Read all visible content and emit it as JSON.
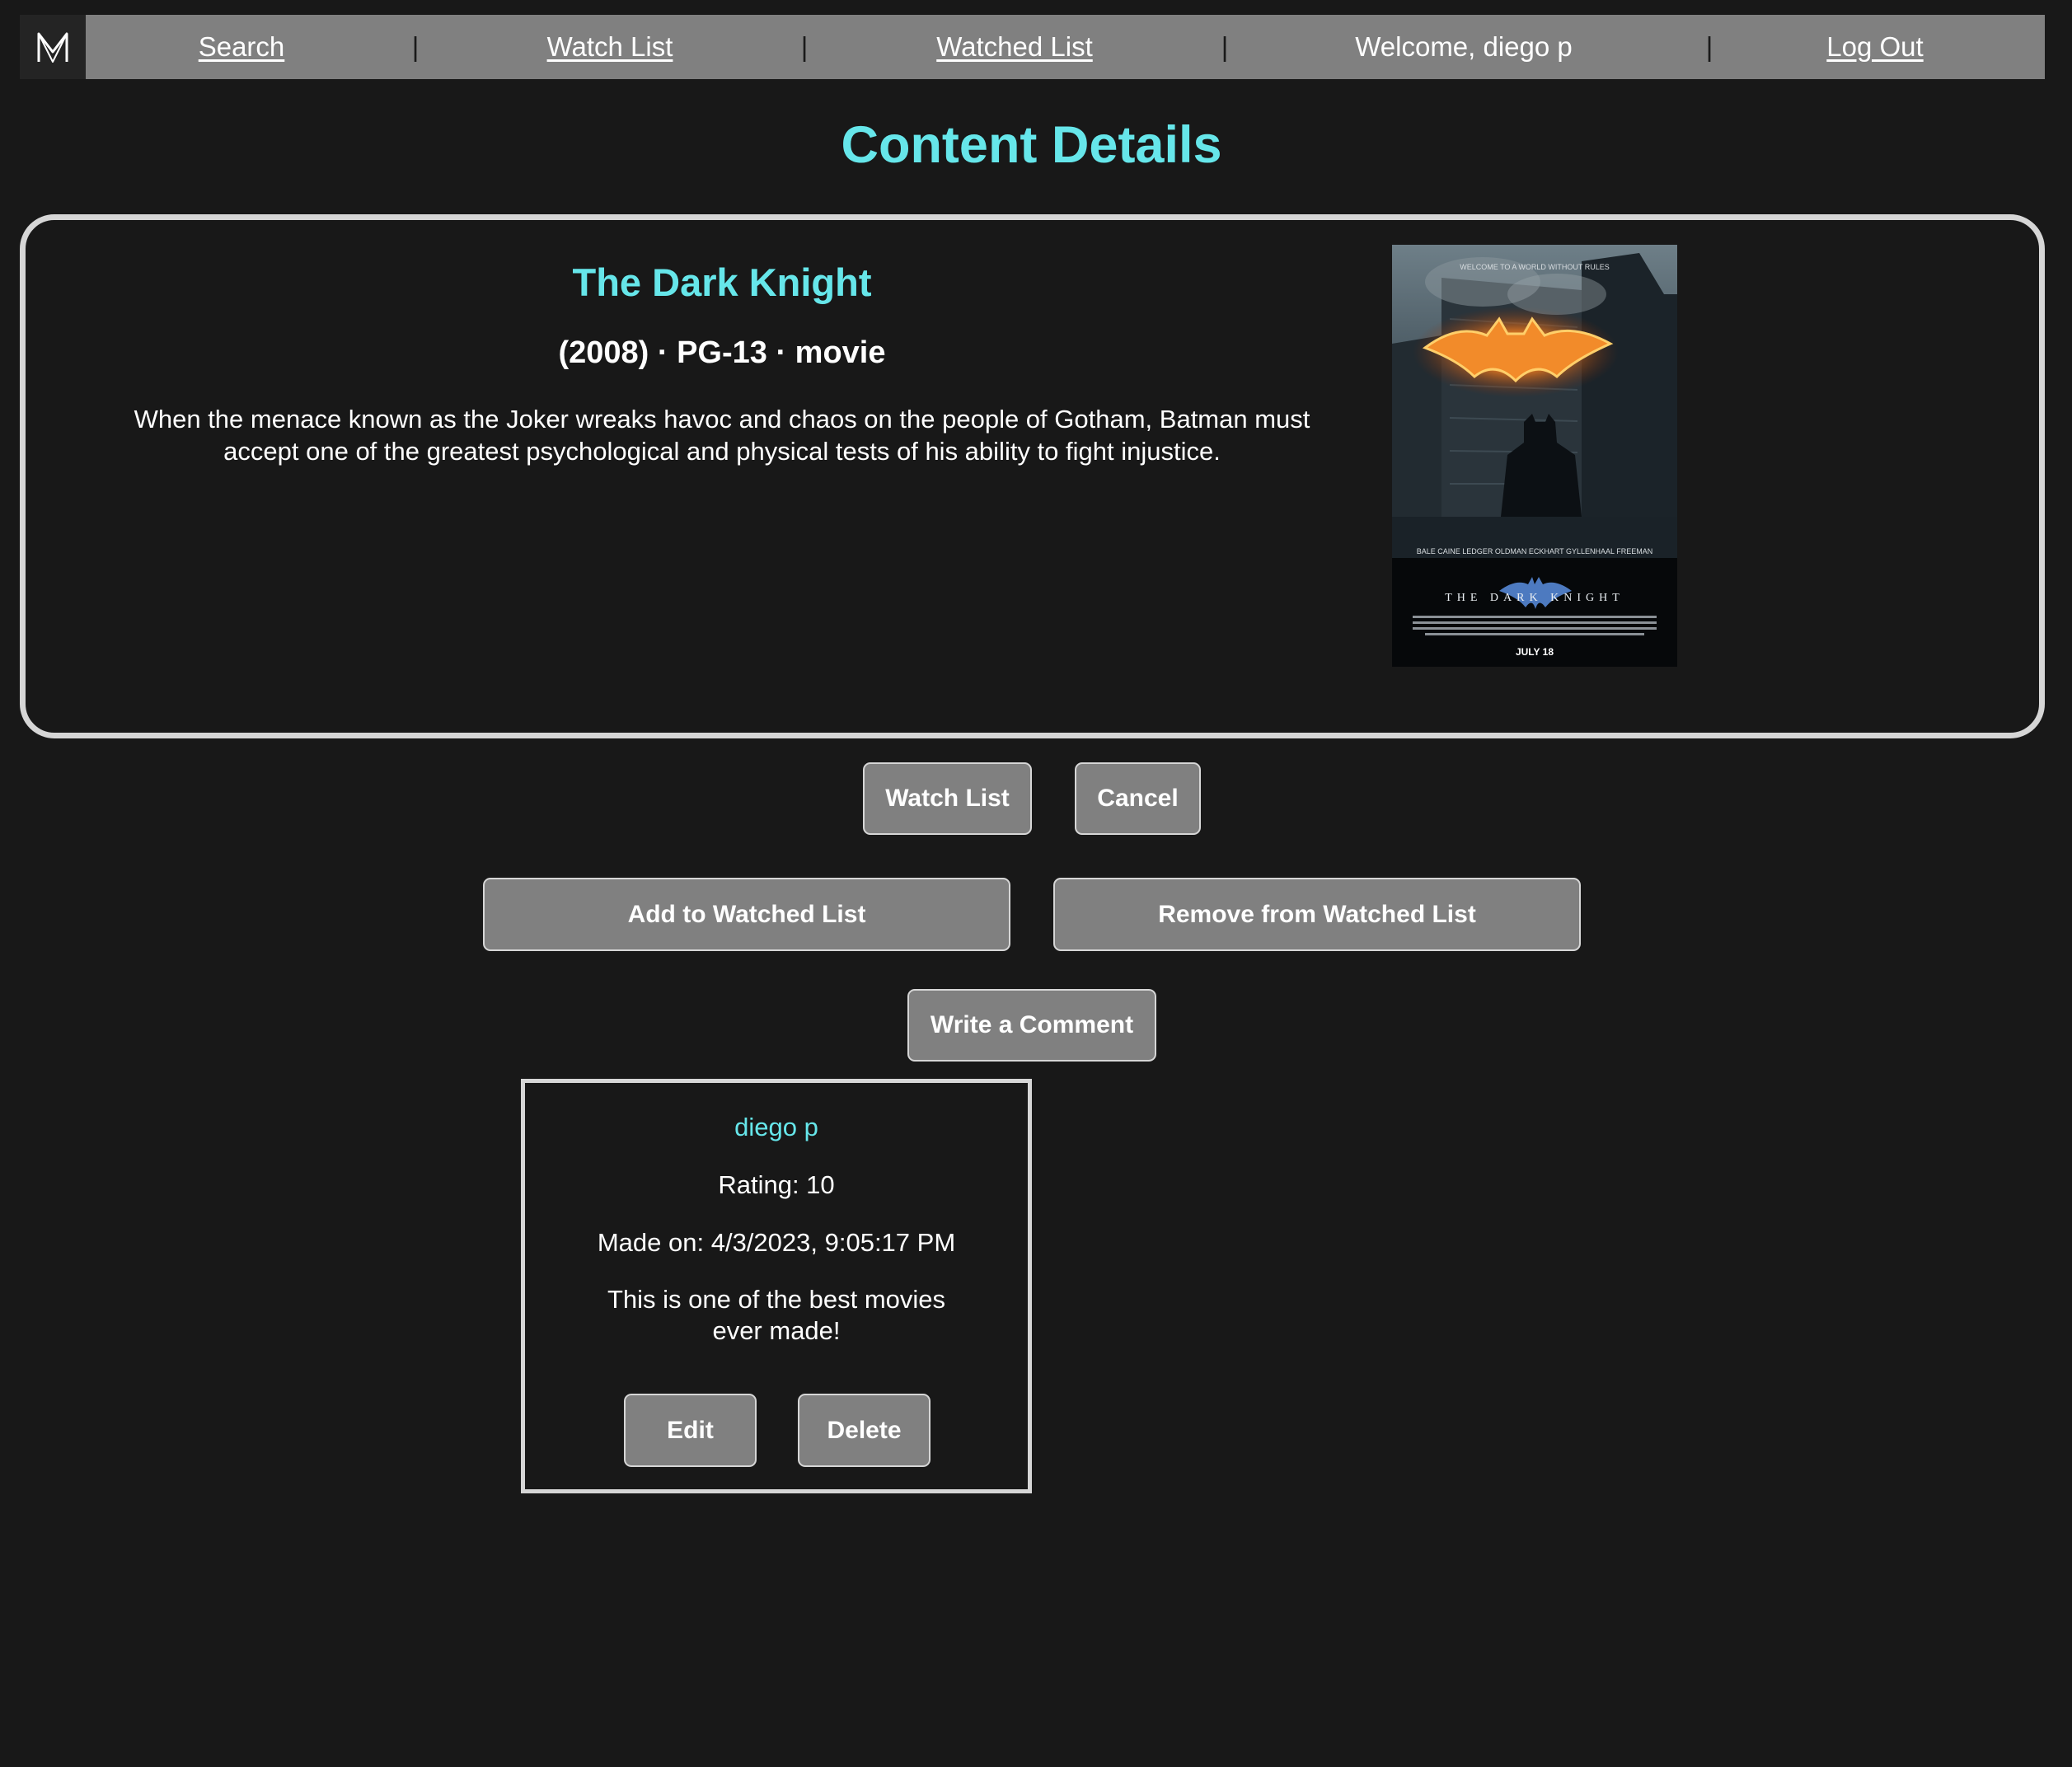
{
  "nav": {
    "search": "Search",
    "watch_list": "Watch List",
    "watched_list": "Watched List",
    "welcome": "Welcome, diego p",
    "log_out": "Log Out",
    "separator": "|"
  },
  "page": {
    "title": "Content Details"
  },
  "content": {
    "title": "The Dark Knight",
    "meta": "(2008) · PG-13 · movie",
    "description": "When the menace known as the Joker wreaks havoc and chaos on the people of Gotham, Batman must accept one of the greatest psychological and physical tests of his ability to fight injustice.",
    "poster": {
      "tagline": "WELCOME TO A WORLD WITHOUT RULES",
      "cast": "BALE  CAINE  LEDGER  OLDMAN  ECKHART  GYLLENHAAL  FREEMAN",
      "title": "THE DARK KNIGHT",
      "date": "JULY 18"
    }
  },
  "actions": {
    "watch_list": "Watch List",
    "cancel": "Cancel",
    "add_watched": "Add to Watched List",
    "remove_watched": "Remove from Watched List",
    "write_comment": "Write a Comment"
  },
  "comment": {
    "user": "diego p",
    "rating": "Rating: 10",
    "made_on": "Made on: 4/3/2023, 9:05:17 PM",
    "text": "This is one of the best movies ever made!",
    "edit": "Edit",
    "delete": "Delete"
  },
  "colors": {
    "background": "#181818",
    "accent": "#66e6ea",
    "nav_bg": "#808080",
    "button_bg": "#808080",
    "border": "#d6d6d6"
  }
}
